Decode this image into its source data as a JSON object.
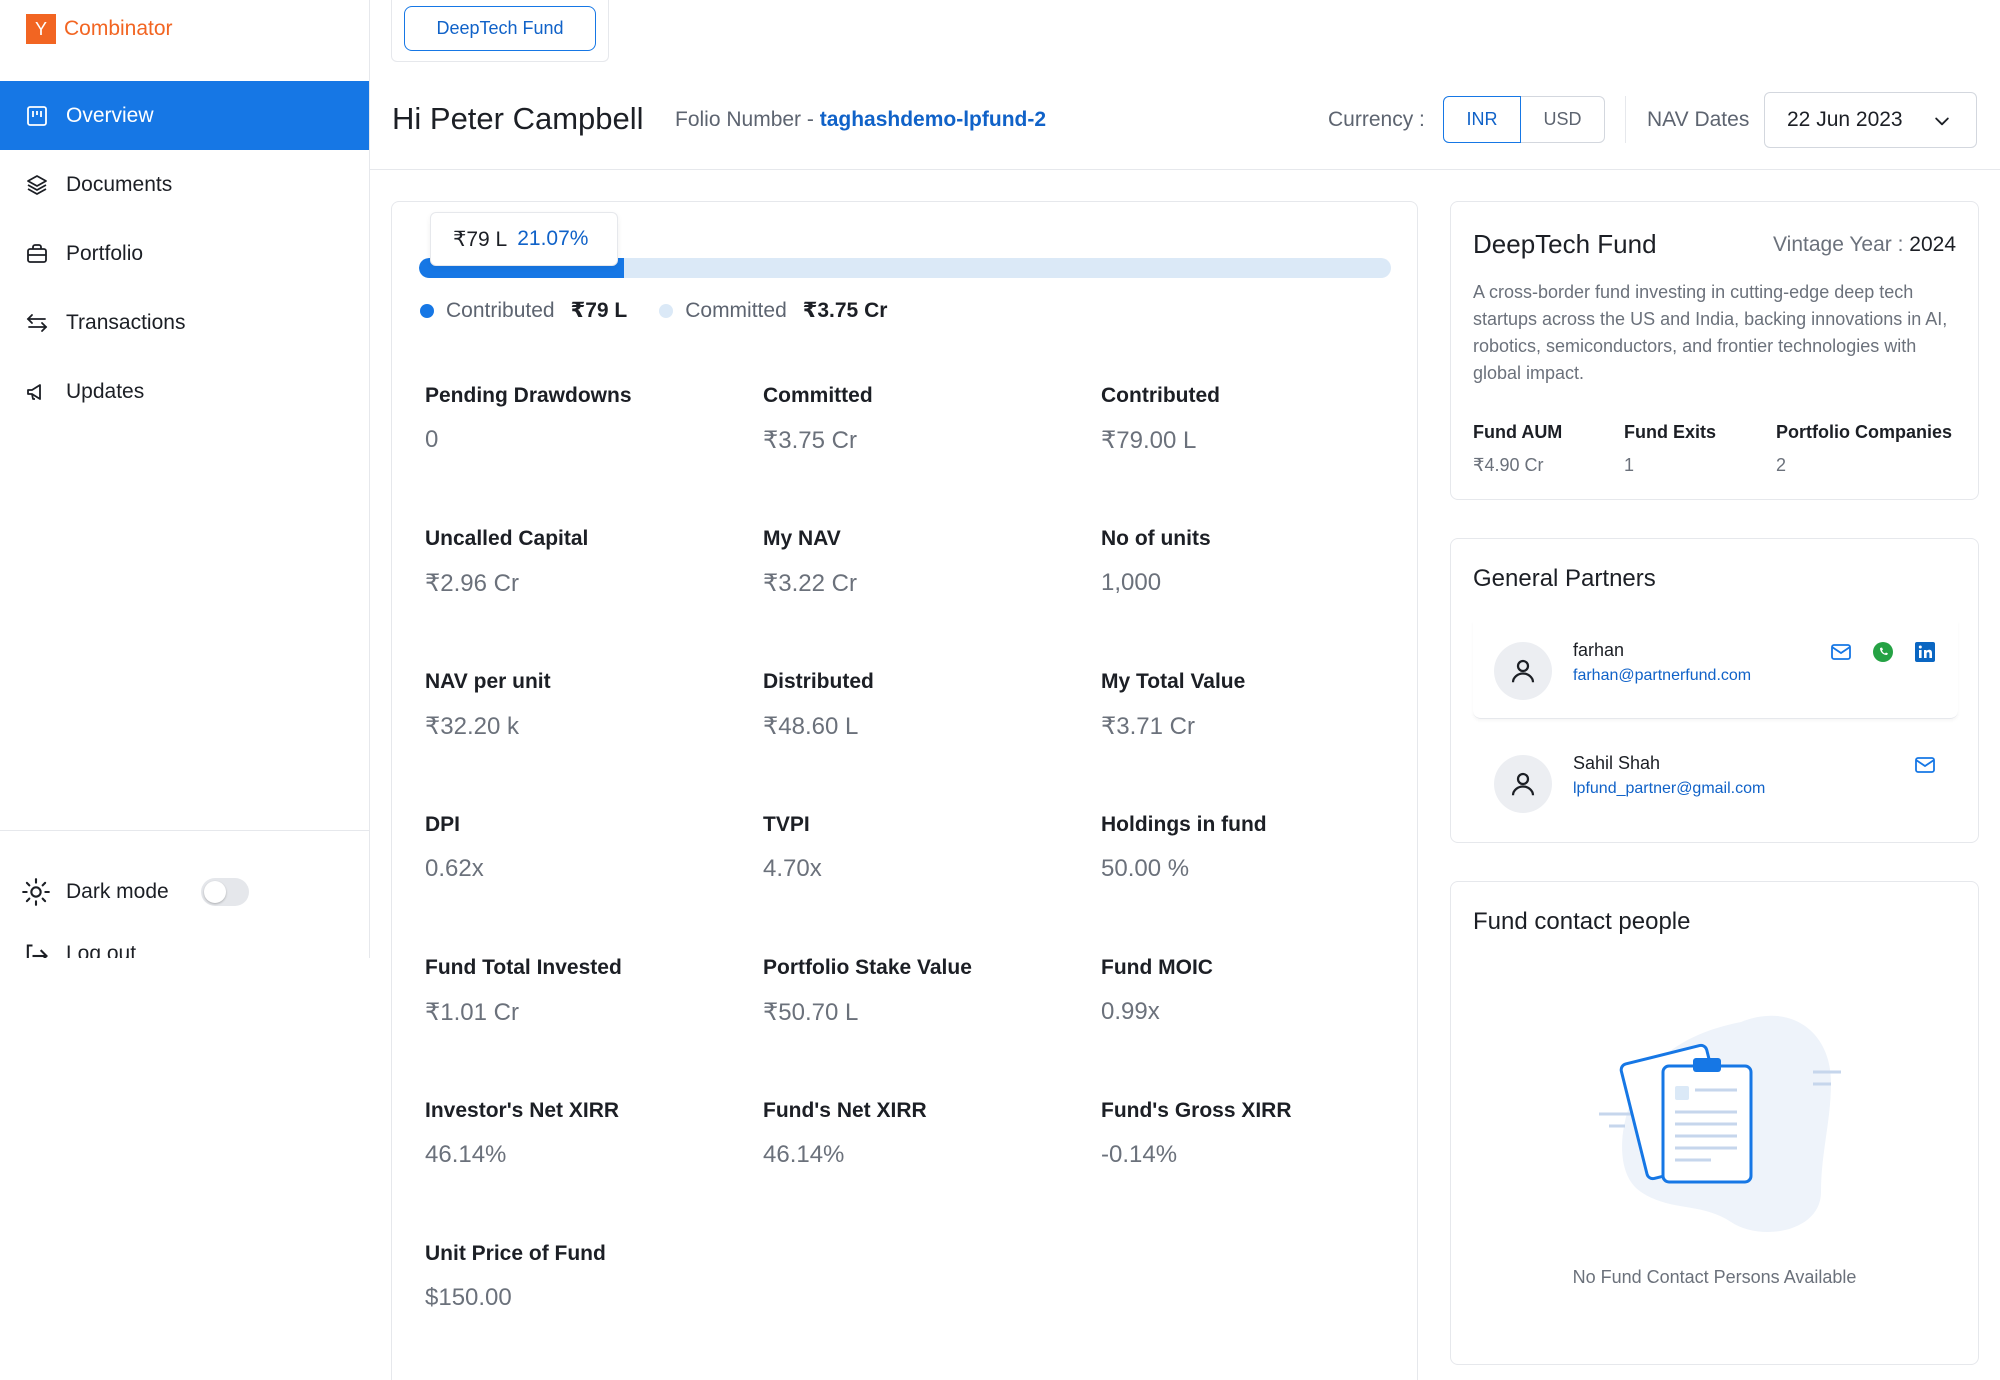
{
  "app": {
    "logo_letter": "Y",
    "logo_text": "Combinator",
    "brand_color": "#f26522",
    "accent_color": "#1677e5"
  },
  "sidebar": {
    "items": [
      {
        "label": "Overview",
        "icon": "overview-icon",
        "active": true
      },
      {
        "label": "Documents",
        "icon": "layers-icon",
        "active": false
      },
      {
        "label": "Portfolio",
        "icon": "briefcase-icon",
        "active": false
      },
      {
        "label": "Transactions",
        "icon": "transfer-icon",
        "active": false
      },
      {
        "label": "Updates",
        "icon": "megaphone-icon",
        "active": false
      }
    ],
    "dark_mode_label": "Dark mode",
    "dark_mode_on": false,
    "logout_label": "Log out"
  },
  "fund_tab": {
    "label": "DeepTech Fund"
  },
  "header": {
    "greeting": "Hi Peter Campbell",
    "folio_label": "Folio Number - ",
    "folio_value": "taghashdemo-lpfund-2",
    "currency_label": "Currency :",
    "currency_options": [
      "INR",
      "USD"
    ],
    "currency_selected": "INR",
    "nav_dates_label": "NAV Dates",
    "nav_date": "22 Jun 2023"
  },
  "progress": {
    "amount": "₹79 L",
    "percent_label": "21.07%",
    "fraction": 0.2107,
    "contributed_label": "Contributed",
    "contributed_value": "₹79 L",
    "committed_label": "Committed",
    "committed_value": "₹3.75 Cr",
    "contributed_color": "#1677e5",
    "committed_color": "#dbe9f7"
  },
  "metrics": [
    {
      "label": "Pending Drawdowns",
      "value": "0"
    },
    {
      "label": "Committed",
      "value": "₹3.75 Cr"
    },
    {
      "label": "Contributed",
      "value": "₹79.00 L"
    },
    {
      "label": "Uncalled Capital",
      "value": "₹2.96 Cr"
    },
    {
      "label": "My NAV",
      "value": "₹3.22 Cr"
    },
    {
      "label": "No of units",
      "value": "1,000"
    },
    {
      "label": "NAV per unit",
      "value": "₹32.20 k"
    },
    {
      "label": "Distributed",
      "value": "₹48.60 L"
    },
    {
      "label": "My Total Value",
      "value": "₹3.71 Cr"
    },
    {
      "label": "DPI",
      "value": "0.62x"
    },
    {
      "label": "TVPI",
      "value": "4.70x"
    },
    {
      "label": "Holdings in fund",
      "value": "50.00 %"
    },
    {
      "label": "Fund Total Invested",
      "value": "₹1.01 Cr"
    },
    {
      "label": "Portfolio Stake Value",
      "value": "₹50.70 L"
    },
    {
      "label": "Fund MOIC",
      "value": "0.99x"
    },
    {
      "label": "Investor's Net XIRR",
      "value": "46.14%"
    },
    {
      "label": "Fund's Net XIRR",
      "value": "46.14%"
    },
    {
      "label": "Fund's Gross XIRR",
      "value": "-0.14%"
    },
    {
      "label": "Unit Price of Fund",
      "value": "$150.00"
    }
  ],
  "fund_card": {
    "title": "DeepTech Fund",
    "vintage_label": "Vintage Year : ",
    "vintage_year": "2024",
    "description": "A cross-border fund investing in cutting-edge deep tech startups across the US and India, backing innovations in AI, robotics, semiconductors, and frontier technologies with global impact.",
    "stats": [
      {
        "label": "Fund AUM",
        "value": "₹4.90 Cr"
      },
      {
        "label": "Fund Exits",
        "value": "1"
      },
      {
        "label": "Portfolio Companies",
        "value": "2"
      }
    ]
  },
  "general_partners": {
    "title": "General Partners",
    "partners": [
      {
        "name": "farhan",
        "email": "farhan@partnerfund.com",
        "icons": [
          "mail-icon",
          "whatsapp-icon",
          "linkedin-icon"
        ]
      },
      {
        "name": "Sahil Shah",
        "email": "lpfund_partner@gmail.com",
        "icons": [
          "mail-icon"
        ]
      }
    ]
  },
  "fund_contacts": {
    "title": "Fund contact people",
    "empty_text": "No Fund Contact Persons Available"
  }
}
